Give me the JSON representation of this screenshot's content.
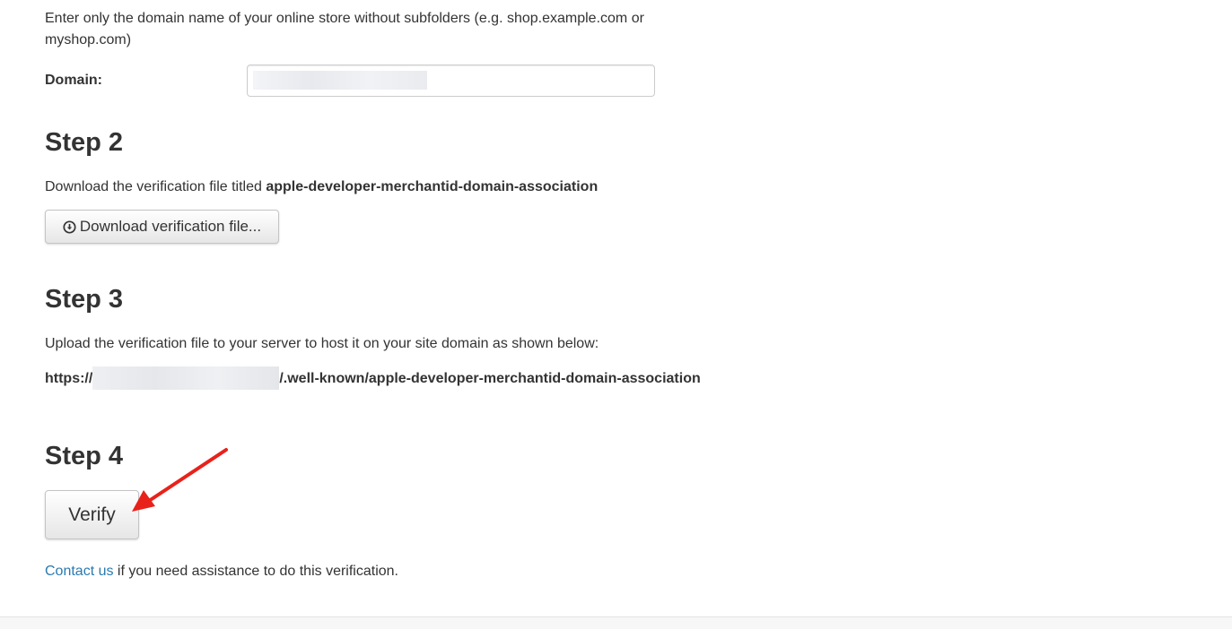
{
  "step1": {
    "instruction": "Enter only the domain name of your online store without subfolders (e.g. shop.example.com or myshop.com)",
    "domain_label": "Domain:",
    "domain_value": ""
  },
  "step2": {
    "heading": "Step 2",
    "instruction_prefix": "Download the verification file titled ",
    "file_name": "apple-developer-merchantid-domain-association",
    "download_button_label": "Download verification file...",
    "download_icon": "circle-arrow-down-icon"
  },
  "step3": {
    "heading": "Step 3",
    "instruction": "Upload the verification file to your server to host it on your site domain as shown below:",
    "url_prefix": "https://",
    "url_suffix": "/.well-known/apple-developer-merchantid-domain-association"
  },
  "step4": {
    "heading": "Step 4",
    "verify_button_label": "Verify"
  },
  "contact": {
    "link_text": "Contact us",
    "rest_text": " if you need assistance to do this verification."
  },
  "colors": {
    "text": "#333333",
    "link": "#2a7ab0",
    "annotation_arrow": "#e8221b"
  }
}
